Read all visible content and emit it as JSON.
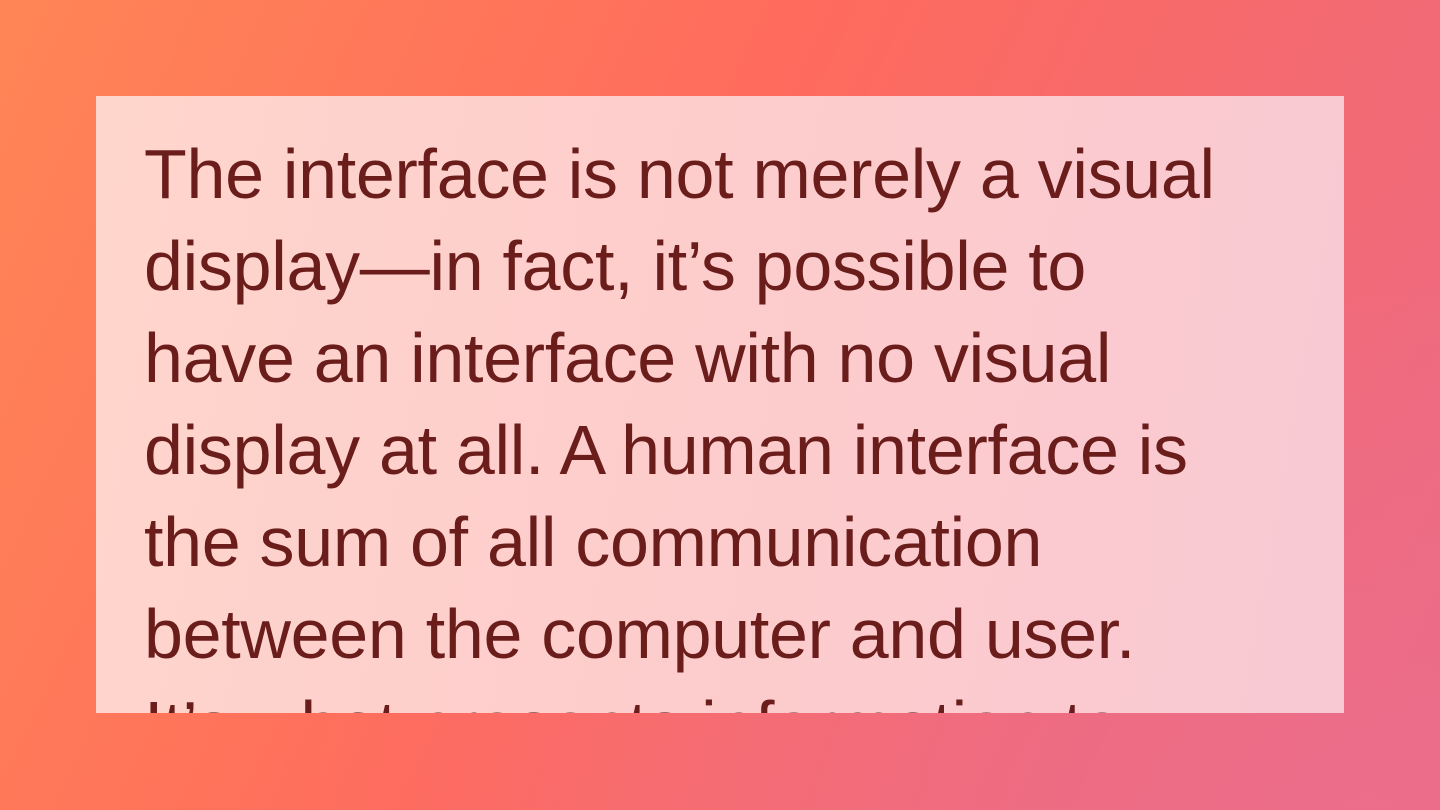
{
  "quote": {
    "lines": [
      "The interface is not merely a visual",
      "display—in fact, it’s possible to",
      "have an interface with no visual",
      "display at all. A human interface is",
      "the sum of all communication",
      "between the computer and user.",
      "It’s what presents information to"
    ]
  },
  "colors": {
    "text": "#6a1d1b",
    "card_background": "#fdcccc",
    "page_gradient_start": "#ff8556",
    "page_gradient_end": "#ec6a84"
  }
}
